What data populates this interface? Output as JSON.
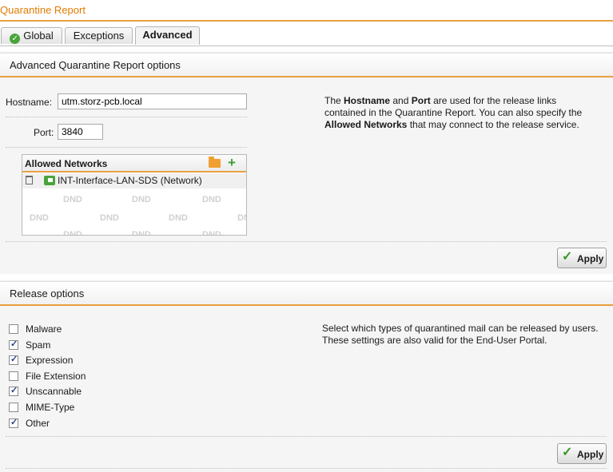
{
  "window": {
    "title": "Quarantine Report"
  },
  "tabs": [
    {
      "label": "Global",
      "icon": "check-circle-icon"
    },
    {
      "label": "Exceptions"
    },
    {
      "label": "Advanced",
      "active": true
    }
  ],
  "advanced": {
    "heading": "Advanced Quarantine Report options",
    "hostname_label": "Hostname:",
    "hostname_value": "utm.storz-pcb.local",
    "port_label": "Port:",
    "port_value": "3840",
    "networks_header": "Allowed Networks",
    "networks": [
      {
        "name": "INT-Interface-LAN-SDS (Network)"
      }
    ],
    "dnd_placeholder": "DND",
    "description": {
      "p1": "The ",
      "b1": "Hostname",
      "p2": " and ",
      "b2": "Port",
      "p3": " are used for the release links contained in the Quarantine Report. You can also specify the ",
      "b3": "Allowed Networks",
      "p4": " that may connect to the release service."
    },
    "apply_label": "Apply"
  },
  "release": {
    "heading": "Release options",
    "options": [
      {
        "label": "Malware",
        "checked": false
      },
      {
        "label": "Spam",
        "checked": true
      },
      {
        "label": "Expression",
        "checked": true
      },
      {
        "label": "File Extension",
        "checked": false
      },
      {
        "label": "Unscannable",
        "checked": true
      },
      {
        "label": "MIME-Type",
        "checked": false
      },
      {
        "label": "Other",
        "checked": true
      }
    ],
    "description_line1": "Select which types of quarantined mail can be released by users.",
    "description_line2": "These settings are also valid for the End-User Portal.",
    "apply_label": "Apply"
  },
  "colors": {
    "accent": "#e8a040",
    "title": "#e07b00",
    "ok_green": "#3a9a2a"
  }
}
